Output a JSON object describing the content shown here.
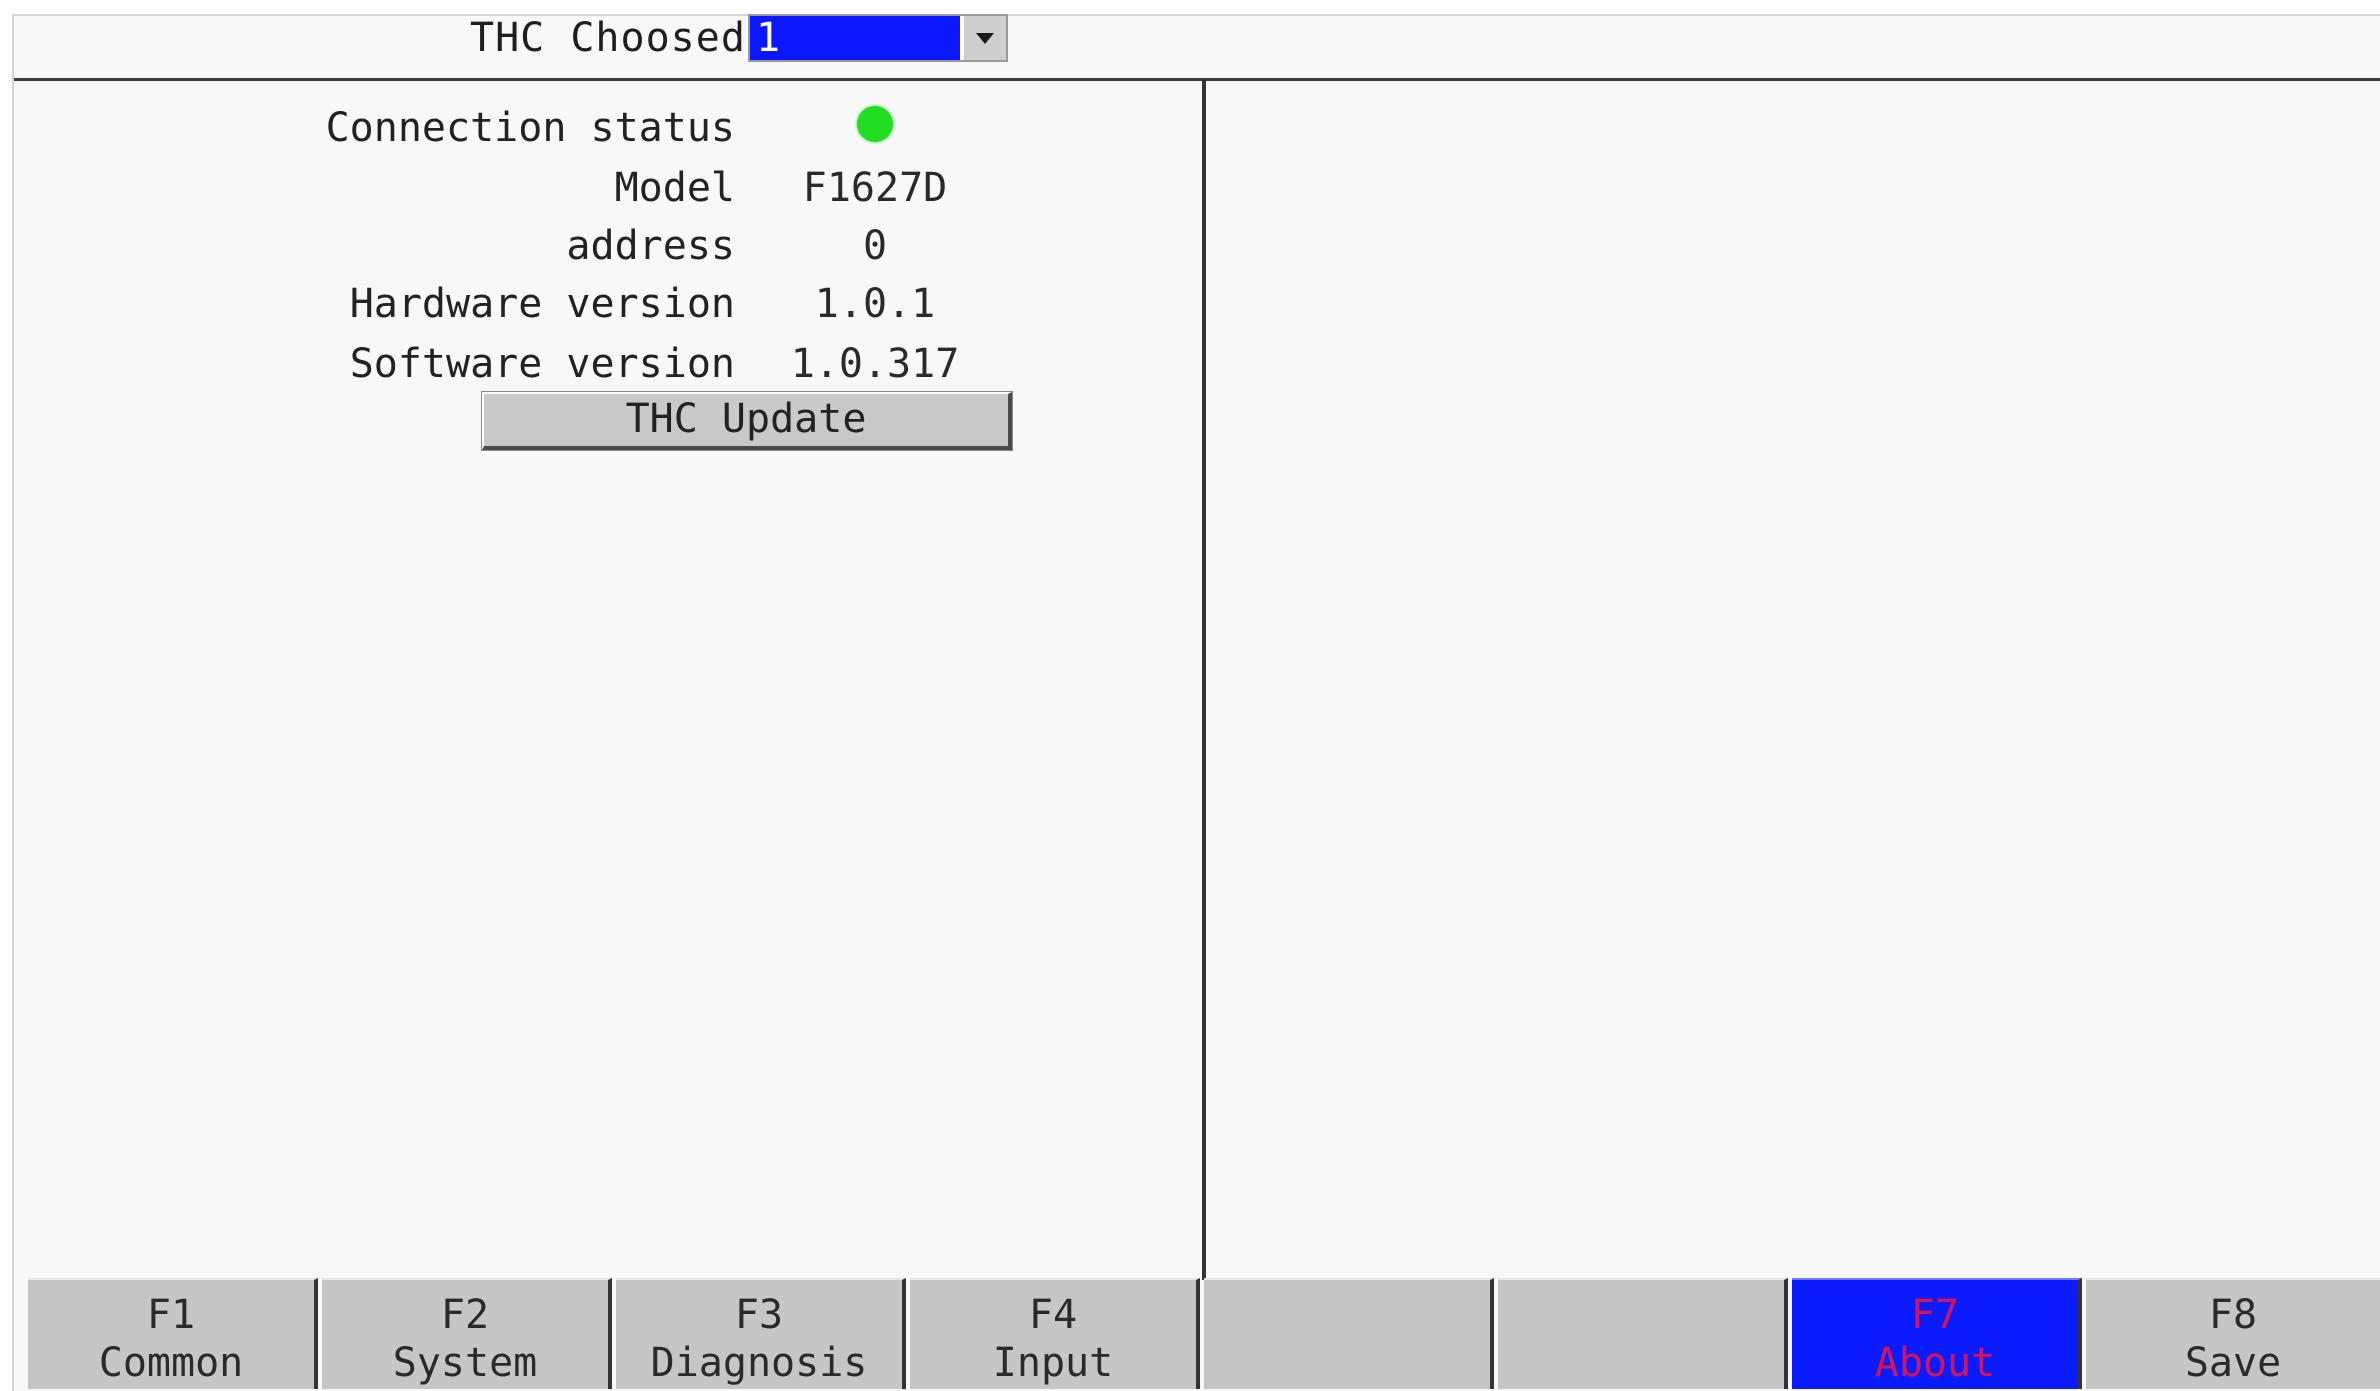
{
  "header": {
    "thc_label": "THC Choosed",
    "thc_selected": "1"
  },
  "info": {
    "connection_label": "Connection status",
    "connection_color": "#22dd22",
    "model_label": "Model",
    "model_value": "F1627D",
    "address_label": "address",
    "address_value": "0",
    "hw_label": "Hardware version",
    "hw_value": "1.0.1",
    "sw_label": "Software version",
    "sw_value": "1.0.317",
    "update_button": "THC Update"
  },
  "fkeys": [
    {
      "key": "F1",
      "name": "Common"
    },
    {
      "key": "F2",
      "name": "System"
    },
    {
      "key": "F3",
      "name": "Diagnosis"
    },
    {
      "key": "F4",
      "name": "Input"
    },
    {
      "key": "",
      "name": ""
    },
    {
      "key": "",
      "name": ""
    },
    {
      "key": "F7",
      "name": "About",
      "active": true
    },
    {
      "key": "F8",
      "name": "Save"
    }
  ],
  "colors": {
    "active_key_bg": "#0a1cff",
    "active_key_text": "#d4145a",
    "selection_bg": "#0b18ff"
  }
}
